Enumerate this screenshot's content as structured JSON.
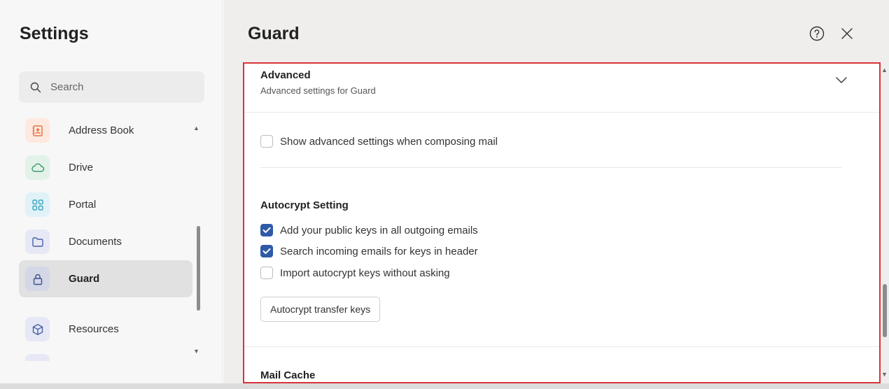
{
  "sidebar": {
    "title": "Settings",
    "search_placeholder": "Search",
    "items": [
      {
        "label": "Address Book",
        "icon": "address-book-icon",
        "color": "#e8744a",
        "bg": "#fde9df"
      },
      {
        "label": "Drive",
        "icon": "cloud-icon",
        "color": "#3f9a6b",
        "bg": "#e2f2e9"
      },
      {
        "label": "Portal",
        "icon": "grid-icon",
        "color": "#3aa6c4",
        "bg": "#e0f2f7"
      },
      {
        "label": "Documents",
        "icon": "folder-icon",
        "color": "#4a5fa8",
        "bg": "#e6e9f5"
      },
      {
        "label": "Guard",
        "icon": "lock-icon",
        "color": "#3d4f8a",
        "bg": "#d3d7e6"
      },
      {
        "label": "Resources",
        "icon": "cube-icon",
        "color": "#4a5fa8",
        "bg": "#e6e9f5"
      }
    ],
    "active": "Guard"
  },
  "main": {
    "title": "Guard",
    "help_icon": "help-circle-icon",
    "close_icon": "close-icon",
    "section": {
      "title": "Advanced",
      "subtitle": "Advanced settings for Guard",
      "expanded": true
    },
    "show_advanced": {
      "label": "Show advanced settings when composing mail",
      "checked": false
    },
    "autocrypt": {
      "title": "Autocrypt Setting",
      "options": [
        {
          "label": "Add your public keys in all outgoing emails",
          "checked": true
        },
        {
          "label": "Search incoming emails for keys in header",
          "checked": true
        },
        {
          "label": "Import autocrypt keys without asking",
          "checked": false
        }
      ],
      "button_label": "Autocrypt transfer keys"
    },
    "mail_cache": {
      "title": "Mail Cache"
    }
  },
  "colors": {
    "accent": "#2f5aa8",
    "highlight_border": "#d8333b",
    "main_bg": "#efeeec",
    "sidebar_bg": "#f7f7f7"
  }
}
